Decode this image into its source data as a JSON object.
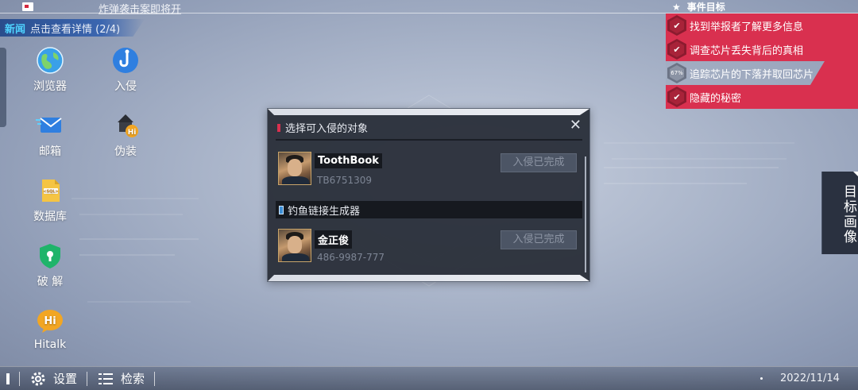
{
  "top": {
    "headline": "炸弹袭击案即将开",
    "news_tag": "新闻",
    "news_text": "点击查看详情 (2/4)"
  },
  "desktop": {
    "icons": [
      {
        "label": "浏览器",
        "icon": "globe-icon"
      },
      {
        "label": "入侵",
        "icon": "hook-icon"
      },
      {
        "label": "邮箱",
        "icon": "mail-icon"
      },
      {
        "label": "伪装",
        "icon": "disguise-icon"
      },
      {
        "label": "数据库",
        "icon": "sql-file-icon"
      },
      {
        "label": "破 解",
        "icon": "shield-key-icon"
      },
      {
        "label": "Hitalk",
        "icon": "hitalk-icon"
      }
    ]
  },
  "objectives": {
    "title": "事件目标",
    "items": [
      {
        "text": "找到举报者了解更多信息",
        "state": "done"
      },
      {
        "text": "调查芯片丢失背后的真相",
        "state": "done"
      },
      {
        "text": "追踪芯片的下落并取回芯片",
        "state": "progress",
        "progress_label": "67%",
        "progress": 0.67
      },
      {
        "text": "隐藏的秘密",
        "state": "done"
      }
    ]
  },
  "side_panel": {
    "label": "目标画像"
  },
  "dialog": {
    "title": "选择可入侵的对象",
    "close": "✕",
    "entries": [
      {
        "name": "ToothBook",
        "sub": "TB6751309",
        "status": "入侵已完成"
      },
      {
        "name": "金正俊",
        "sub": "486-9987-777",
        "status": "入侵已完成"
      }
    ],
    "section_title": "钓鱼链接生成器"
  },
  "taskbar": {
    "settings_label": "设置",
    "search_label": "检索",
    "date": "2022/11/14"
  },
  "colors": {
    "accent_red": "#d9304f",
    "news_cyan": "#4fd3ff",
    "dialog_bg": "#2b303a"
  }
}
